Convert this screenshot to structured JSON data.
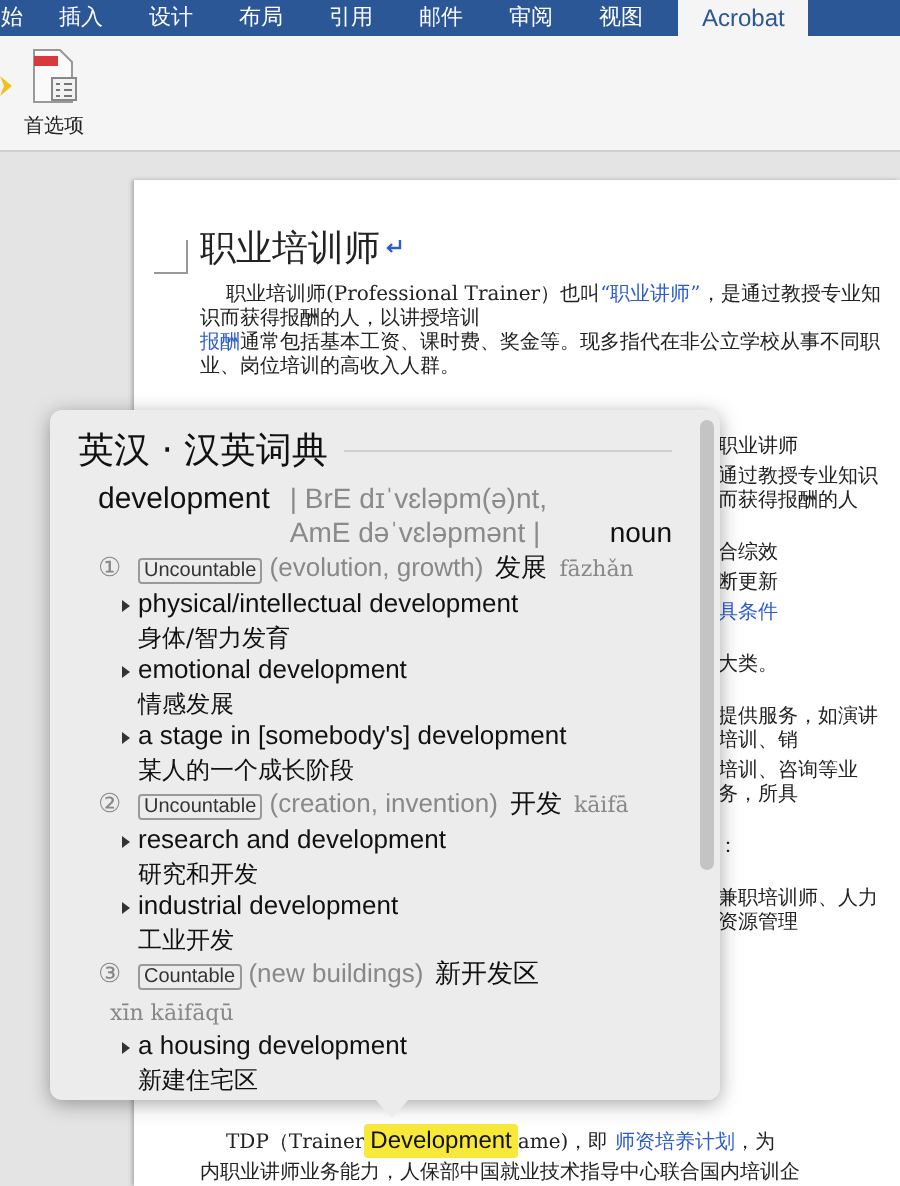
{
  "ribbon": {
    "tabs": [
      {
        "label": "始",
        "selected": false
      },
      {
        "label": "插入",
        "selected": false
      },
      {
        "label": "设计",
        "selected": false
      },
      {
        "label": "布局",
        "selected": false
      },
      {
        "label": "引用",
        "selected": false
      },
      {
        "label": "邮件",
        "selected": false
      },
      {
        "label": "审阅",
        "selected": false
      },
      {
        "label": "视图",
        "selected": false
      },
      {
        "label": "Acrobat",
        "selected": true
      }
    ]
  },
  "toolbar": {
    "buttons": [
      {
        "label": "首选项"
      }
    ]
  },
  "document": {
    "title": "职业培训师",
    "paragraph_lines": [
      [
        {
          "text": "职业培训师(Professional Trainer）也叫",
          "link": false
        },
        {
          "text": "“职业讲师”",
          "link": true
        },
        {
          "text": "，是通过教授专业知识而获得报酬的人，以讲授培训",
          "link": false
        }
      ],
      [
        {
          "text": "报酬",
          "link": true
        },
        {
          "text": "通常包括基本工资、课时费、奖金等。现多指代在非公立学校从事不同职业、岗位培训的高收入人群。",
          "link": false
        }
      ]
    ],
    "side_blocks": [
      [
        {
          "text": "职业讲师",
          "link": false
        },
        {
          "text": "通过教授专业知识而获得报酬的人",
          "link": false
        }
      ],
      [
        {
          "text": "合综效",
          "link": false
        },
        {
          "text": "断更新",
          "link": false
        },
        {
          "text": "具条件",
          "link": true
        }
      ],
      [
        {
          "text": "大类。",
          "link": false
        }
      ],
      [
        {
          "text": "提供服务，如演讲培训、销",
          "link": false
        },
        {
          "text": "培训、咨询等业务，所具",
          "link": false
        }
      ],
      [
        {
          "text": "：",
          "link": false
        }
      ],
      [
        {
          "text": "兼职培训师、人力资源管理",
          "link": false
        }
      ]
    ],
    "bottom_lines": [
      [
        {
          "text": "TDP（Trainer",
          "link": false
        },
        {
          "text": "ame)，即 ",
          "link": false
        },
        {
          "text": "师资培养计划",
          "link": true
        },
        {
          "text": "，为",
          "link": false
        }
      ],
      [
        {
          "text": "内职业讲师业务能力，人保部中国就业技术指导中心联合国内培训企",
          "link": false
        }
      ]
    ],
    "lookup_word": "Development"
  },
  "dictionary_popup": {
    "title": "英汉 · 汉英词典",
    "headword": "development",
    "pronunciation": "| BrE dɪˈvɛləpm(ə)nt, AmE dəˈvɛləpmənt |",
    "part_of_speech": "noun",
    "senses": [
      {
        "number": "①",
        "label": "Uncountable",
        "gloss": "(evolution, growth)",
        "translation": "发展",
        "pinyin": "fāzhǎn",
        "examples": [
          {
            "en": "physical/intellectual development",
            "zh": "身体/智力发育"
          },
          {
            "en": "emotional development",
            "zh": "情感发展"
          },
          {
            "en": "a stage in [somebody's] development",
            "zh": "某人的一个成长阶段"
          }
        ]
      },
      {
        "number": "②",
        "label": "Uncountable",
        "gloss": "(creation, invention)",
        "translation": "开发",
        "pinyin": "kāifā",
        "examples": [
          {
            "en": "research and development",
            "zh": "研究和开发"
          },
          {
            "en": "industrial development",
            "zh": "工业开发"
          }
        ]
      },
      {
        "number": "③",
        "label": "Countable",
        "gloss": "(new buildings)",
        "translation": "新开发区",
        "pinyin": "xīn kāifāqū",
        "examples": [
          {
            "en": "a housing development",
            "zh": "新建住宅区"
          }
        ]
      }
    ]
  }
}
